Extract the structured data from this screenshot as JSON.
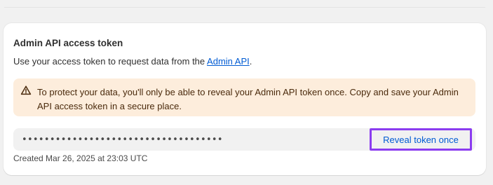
{
  "card": {
    "title": "Admin API access token",
    "description_prefix": "Use your access token to request data from the ",
    "description_link": "Admin API",
    "description_suffix": "."
  },
  "warning": {
    "icon": "warning-triangle-icon",
    "text": "To protect your data, you'll only be able to reveal your Admin API token once. Copy and save your Admin API access token in a secure place."
  },
  "token": {
    "masked_value": "••••••••••••••••••••••••••••••••••••",
    "reveal_label": "Reveal token once"
  },
  "meta": {
    "created_text": "Created Mar 26, 2025 at 23:03 UTC"
  },
  "colors": {
    "link": "#005bd3",
    "banner_bg": "#fdeddc",
    "highlight": "#8b3cf0"
  }
}
